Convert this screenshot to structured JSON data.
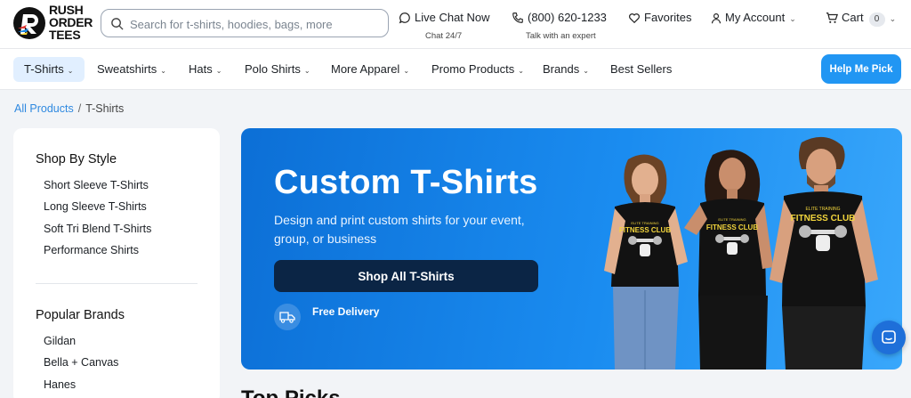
{
  "brand": {
    "line1": "RUSH",
    "line2": "ORDER",
    "line3": "TEES"
  },
  "search": {
    "placeholder": "Search for t-shirts, hoodies, bags, more"
  },
  "header": {
    "live_chat": "Live Chat Now",
    "live_chat_sub": "Chat 24/7",
    "phone": "(800) 620-1233",
    "phone_sub": "Talk with an expert",
    "favorites": "Favorites",
    "account": "My Account",
    "cart": "Cart",
    "cart_count": "0"
  },
  "nav": {
    "items": [
      "T-Shirts",
      "Sweatshirts",
      "Hats",
      "Polo Shirts",
      "More Apparel",
      "Promo Products",
      "Brands",
      "Best Sellers"
    ],
    "help_button": "Help Me Pick"
  },
  "breadcrumb": {
    "root": "All Products",
    "sep": "/",
    "current": "T-Shirts"
  },
  "sidebar": {
    "style_heading": "Shop By Style",
    "styles": [
      "Short Sleeve T-Shirts",
      "Long Sleeve T-Shirts",
      "Soft Tri Blend T-Shirts",
      "Performance Shirts"
    ],
    "brands_heading": "Popular Brands",
    "brands": [
      "Gildan",
      "Bella + Canvas",
      "Hanes"
    ]
  },
  "hero": {
    "title": "Custom T-Shirts",
    "subtitle": "Design and print custom shirts for your event, group, or business",
    "button": "Shop All T-Shirts",
    "delivery": "Free Delivery",
    "shirt_text_small": "ELITE TRAINING",
    "shirt_text_big": "FITNESS CLUB"
  },
  "section": {
    "heading": "Top Picks"
  },
  "colors": {
    "accent": "#2196f3",
    "hero_dark": "#0b2545",
    "link": "#2f89e0"
  }
}
